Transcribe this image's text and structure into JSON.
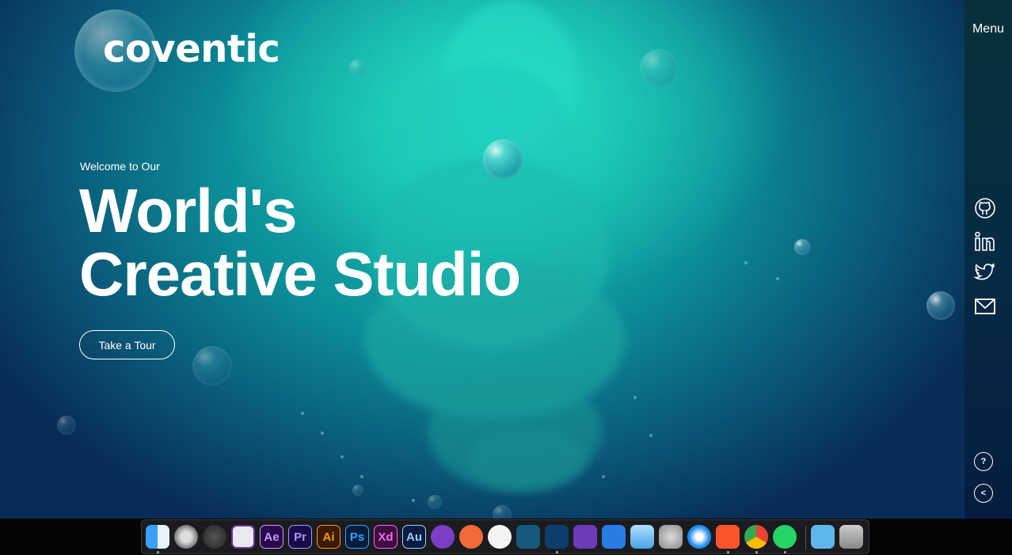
{
  "brand": {
    "logo_text": "coventic"
  },
  "hero": {
    "welcome": "Welcome to Our",
    "headline_line1": "World's",
    "headline_line2": "Creative Studio",
    "cta_label": "Take a Tour"
  },
  "sidebar": {
    "menu_label": "Menu",
    "social": [
      "github-icon",
      "linkedin-icon",
      "twitter-icon",
      "mail-icon"
    ],
    "help_label": "?",
    "share_label": "<"
  },
  "dock": {
    "apps": [
      {
        "name": "finder",
        "label": ""
      },
      {
        "name": "launchpad",
        "label": ""
      },
      {
        "name": "alfred",
        "label": ""
      },
      {
        "name": "affinity",
        "label": ""
      },
      {
        "name": "after-effects",
        "label": "Ae"
      },
      {
        "name": "premiere-pro",
        "label": "Pr"
      },
      {
        "name": "illustrator",
        "label": "Ai"
      },
      {
        "name": "photoshop",
        "label": "Ps"
      },
      {
        "name": "xd",
        "label": "Xd"
      },
      {
        "name": "audition",
        "label": "Au"
      },
      {
        "name": "github-desktop",
        "label": ""
      },
      {
        "name": "sketch-pen",
        "label": ""
      },
      {
        "name": "tableplus",
        "label": ""
      },
      {
        "name": "mysql-workbench",
        "label": ""
      },
      {
        "name": "vscode",
        "label": ""
      },
      {
        "name": "visual-studio",
        "label": ""
      },
      {
        "name": "xcode",
        "label": ""
      },
      {
        "name": "virtualbox",
        "label": ""
      },
      {
        "name": "system-preferences",
        "label": ""
      },
      {
        "name": "safari",
        "label": ""
      },
      {
        "name": "brave",
        "label": ""
      },
      {
        "name": "chrome",
        "label": ""
      },
      {
        "name": "whatsapp",
        "label": ""
      },
      {
        "name": "applications-folder",
        "label": ""
      },
      {
        "name": "trash",
        "label": ""
      }
    ],
    "colors": {
      "ae": "#2a0a4a",
      "pr": "#1b0a46",
      "ai": "#3a1a00",
      "ps": "#061c3a",
      "xd": "#3b0f40",
      "au": "#0a1c3f"
    }
  }
}
